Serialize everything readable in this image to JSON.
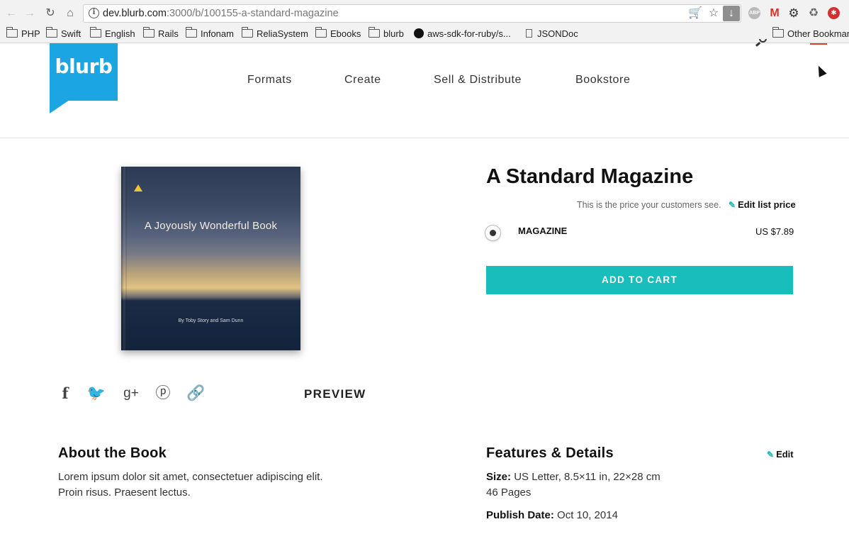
{
  "browser": {
    "url_host": "dev.blurb.com",
    "url_rest": ":3000/b/100155-a-standard-magazine",
    "bookmarks": [
      "PHP",
      "Swift",
      "English",
      "Rails",
      "Infonam",
      "ReliaSystem",
      "Ebooks",
      "blurb",
      "aws-sdk-for-ruby/s...",
      "JSONDoc",
      "Other Bookmar"
    ],
    "icons": [
      "back-icon",
      "forward-icon",
      "reload-icon",
      "home-icon",
      "info-icon",
      "cart-icon",
      "star-icon",
      "download-icon",
      "adblock-icon",
      "gmail-icon",
      "gear-icon",
      "recycle-icon",
      "lastpass-icon"
    ]
  },
  "site": {
    "logo_text": "blurb",
    "brand_color": "#1ba6e3",
    "nav": [
      "Formats",
      "Create",
      "Sell & Distribute",
      "Bookstore"
    ]
  },
  "book": {
    "cover_title": "A Joyously Wonderful Book",
    "cover_author": "By Toby Story and Sam Dunn",
    "preview_label": "PREVIEW",
    "social_icons": [
      "facebook-icon",
      "twitter-icon",
      "google-plus-icon",
      "pinterest-icon",
      "link-icon"
    ]
  },
  "product": {
    "title": "A Standard Magazine",
    "price_note": "This is the price your customers see.",
    "edit_price_label": "Edit list price",
    "format_label": "MAGAZINE",
    "format_price": "US $7.89",
    "add_to_cart": "ADD TO CART",
    "accent_color": "#19bdbc"
  },
  "about": {
    "heading": "About the Book",
    "body_line1": "Lorem ipsum dolor sit amet, consectetuer adipiscing elit.",
    "body_line2": "Proin risus. Praesent lectus."
  },
  "features": {
    "heading": "Features & Details",
    "edit_label": "Edit",
    "size_label": "Size:",
    "size_value": "US Letter, 8.5×11 in, 22×28 cm",
    "pages": "46 Pages",
    "publish_label": "Publish Date:",
    "publish_value": "Oct 10, 2014"
  }
}
